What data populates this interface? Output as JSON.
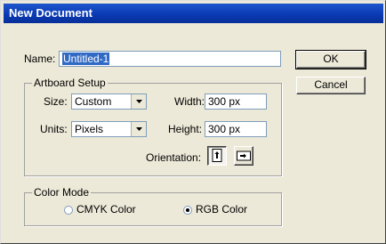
{
  "window": {
    "title": "New Document"
  },
  "name_field": {
    "label": "Name:",
    "value": "Untitled-1"
  },
  "buttons": {
    "ok": "OK",
    "cancel": "Cancel"
  },
  "artboard": {
    "legend": "Artboard Setup",
    "size_label": "Size:",
    "size_value": "Custom",
    "units_label": "Units:",
    "units_value": "Pixels",
    "width_label": "Width:",
    "width_value": "300 px",
    "height_label": "Height:",
    "height_value": "300 px",
    "orientation_label": "Orientation:",
    "orientation_selected": "portrait",
    "icons": [
      "portrait-orientation-icon",
      "landscape-orientation-icon",
      "dropdown-arrow-icon"
    ]
  },
  "color_mode": {
    "legend": "Color Mode",
    "options": [
      "CMYK Color",
      "RGB Color"
    ],
    "selected": "RGB Color"
  }
}
